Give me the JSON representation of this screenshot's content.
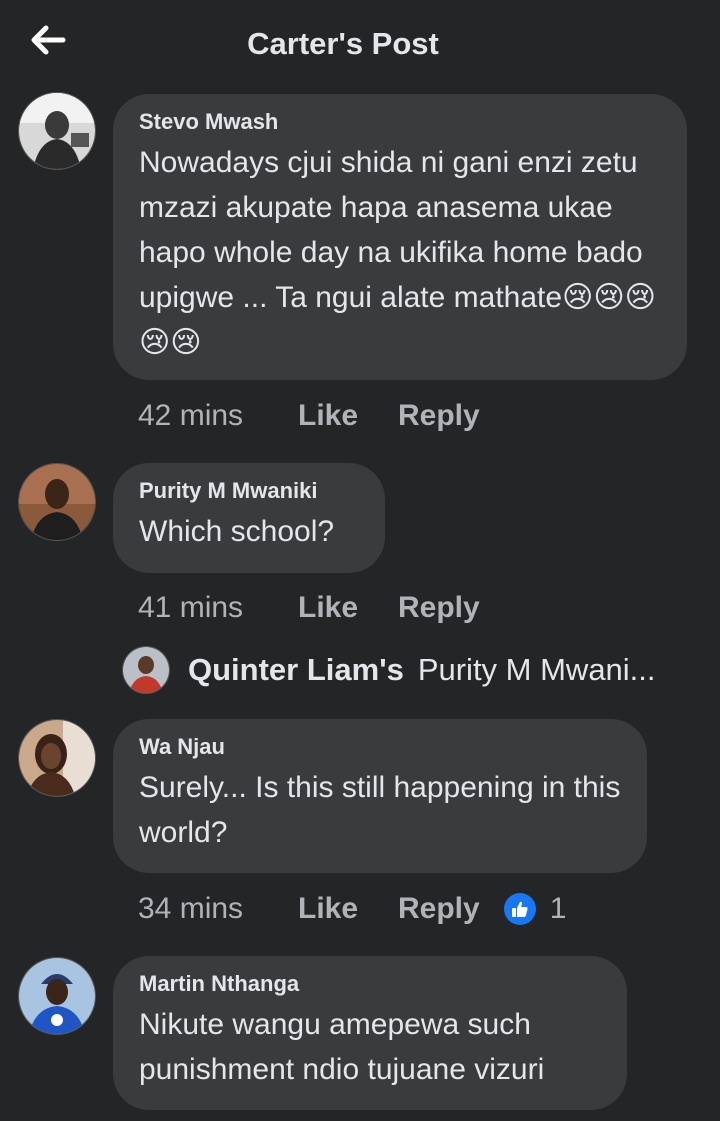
{
  "header": {
    "title": "Carter's Post",
    "back_icon": "arrow-left-icon"
  },
  "comments": [
    {
      "author": "Stevo Mwash",
      "text": "Nowadays cjui shida ni gani enzi zetu mzazi akupate hapa anasema ukae hapo whole day na ukifika home bado upigwe ... Ta ngui alate mathate😢😢😢😢😢",
      "time": "42 mins",
      "like_label": "Like",
      "reply_label": "Reply"
    },
    {
      "author": "Purity M Mwaniki",
      "text": "Which school?",
      "time": "41 mins",
      "like_label": "Like",
      "reply_label": "Reply",
      "reply_preview": {
        "author": "Quinter Liam's",
        "text": "Purity M Mwani..."
      }
    },
    {
      "author": "Wa Njau",
      "text": "Surely... Is this still happening in this world?",
      "time": "34 mins",
      "like_label": "Like",
      "reply_label": "Reply",
      "reactions": "1"
    },
    {
      "author": "Martin Nthanga",
      "text": "Nikute wangu amepewa such punishment ndio tujuane vizuri"
    }
  ],
  "colors": {
    "background": "#242526",
    "bubble": "#3a3b3c",
    "text": "#e4e6eb",
    "secondary_text": "#b0b3b8",
    "like_blue": "#1877f2"
  }
}
